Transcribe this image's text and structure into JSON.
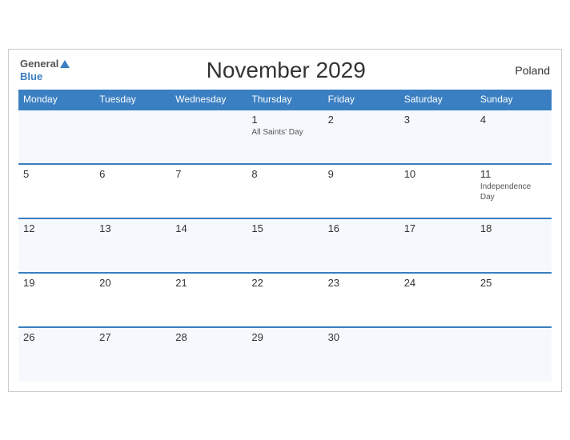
{
  "header": {
    "logo_general": "General",
    "logo_blue": "Blue",
    "title": "November 2029",
    "country": "Poland"
  },
  "weekdays": [
    "Monday",
    "Tuesday",
    "Wednesday",
    "Thursday",
    "Friday",
    "Saturday",
    "Sunday"
  ],
  "weeks": [
    [
      {
        "day": "",
        "event": ""
      },
      {
        "day": "",
        "event": ""
      },
      {
        "day": "",
        "event": ""
      },
      {
        "day": "1",
        "event": "All Saints' Day"
      },
      {
        "day": "2",
        "event": ""
      },
      {
        "day": "3",
        "event": ""
      },
      {
        "day": "4",
        "event": ""
      }
    ],
    [
      {
        "day": "5",
        "event": ""
      },
      {
        "day": "6",
        "event": ""
      },
      {
        "day": "7",
        "event": ""
      },
      {
        "day": "8",
        "event": ""
      },
      {
        "day": "9",
        "event": ""
      },
      {
        "day": "10",
        "event": ""
      },
      {
        "day": "11",
        "event": "Independence Day"
      }
    ],
    [
      {
        "day": "12",
        "event": ""
      },
      {
        "day": "13",
        "event": ""
      },
      {
        "day": "14",
        "event": ""
      },
      {
        "day": "15",
        "event": ""
      },
      {
        "day": "16",
        "event": ""
      },
      {
        "day": "17",
        "event": ""
      },
      {
        "day": "18",
        "event": ""
      }
    ],
    [
      {
        "day": "19",
        "event": ""
      },
      {
        "day": "20",
        "event": ""
      },
      {
        "day": "21",
        "event": ""
      },
      {
        "day": "22",
        "event": ""
      },
      {
        "day": "23",
        "event": ""
      },
      {
        "day": "24",
        "event": ""
      },
      {
        "day": "25",
        "event": ""
      }
    ],
    [
      {
        "day": "26",
        "event": ""
      },
      {
        "day": "27",
        "event": ""
      },
      {
        "day": "28",
        "event": ""
      },
      {
        "day": "29",
        "event": ""
      },
      {
        "day": "30",
        "event": ""
      },
      {
        "day": "",
        "event": ""
      },
      {
        "day": "",
        "event": ""
      }
    ]
  ]
}
